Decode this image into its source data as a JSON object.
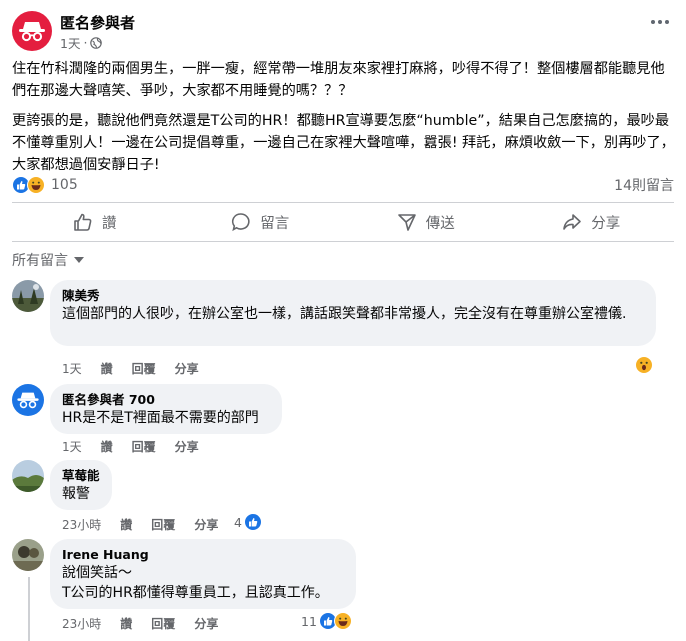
{
  "post": {
    "author": "匿名參與者",
    "time": "1天",
    "paragraph1": "住在竹科潤隆的兩個男生，一胖一瘦，經常帶一堆朋友來家裡打麻將，吵得不得了！整個樓層都能聽見他們在那邊大聲嘻笑、爭吵，大家都不用睡覺的嗎？？？",
    "paragraph2": "更誇張的是，聽說他們竟然還是T公司的HR！都聽HR宣導要怎麼“humble”，結果自己怎麼搞的，最吵最不懂尊重別人！一邊在公司提倡尊重，一邊自己在家裡大聲喧嘩，囂張! 拜託，麻煩收斂一下，別再吵了，大家都想過個安靜日子!",
    "reaction_count": "105",
    "comment_count": "14則留言"
  },
  "actions": {
    "like": "讚",
    "comment": "留言",
    "send": "傳送",
    "share": "分享"
  },
  "sort_label": "所有留言",
  "comments": [
    {
      "name": "陳美秀",
      "text": "這個部門的人很吵，在辦公室也一樣，講話跟笑聲都非常擾人，完全沒有在尊重辦公室禮儀.",
      "time": "1天",
      "like": "讚",
      "reply": "回覆",
      "share": "分享"
    },
    {
      "name": "匿名參與者 700",
      "text": "HR是不是T裡面最不需要的部門",
      "time": "1天",
      "like": "讚",
      "reply": "回覆",
      "share": "分享"
    },
    {
      "name": "草莓能",
      "text": "報警",
      "time": "23小時",
      "like": "讚",
      "reply": "回覆",
      "share": "分享",
      "reactions": "4"
    },
    {
      "name": "Irene Huang",
      "line1": "說個笑話～",
      "line2": "T公司的HR都懂得尊重員工，且認真工作。",
      "time": "23小時",
      "like": "讚",
      "reply": "回覆",
      "share": "分享",
      "reactions": "11"
    }
  ],
  "colors": {
    "like_blue": "#1b74e4",
    "anon_red": "#e41e3f",
    "secondary_text": "#65676b",
    "bubble_bg": "#f0f2f5"
  }
}
